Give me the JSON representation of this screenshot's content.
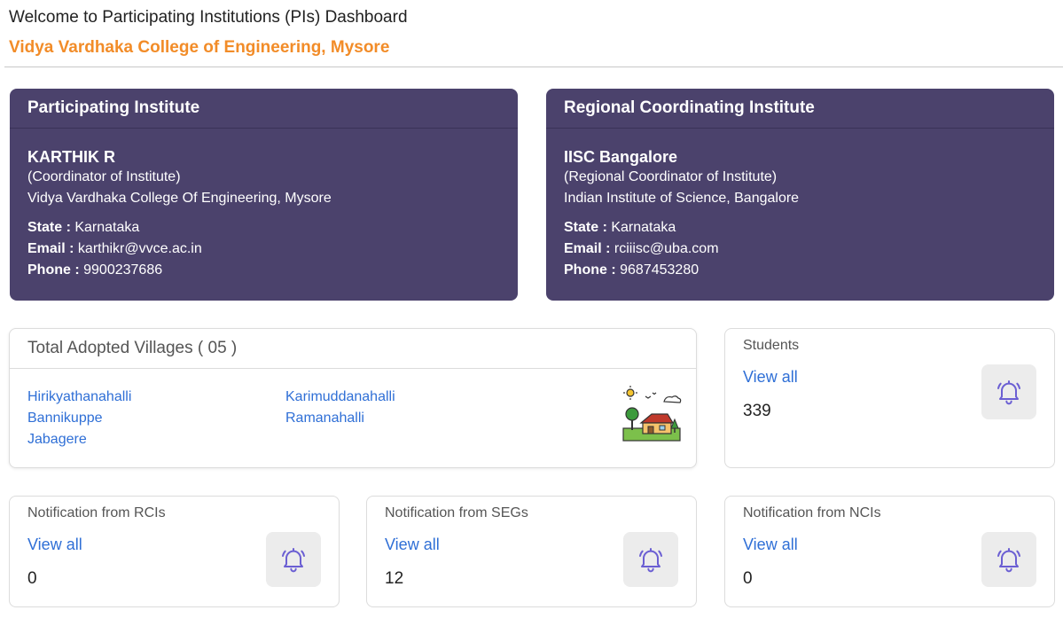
{
  "header": {
    "welcome": "Welcome to Participating Institutions (PIs) Dashboard",
    "college": "Vidya Vardhaka College of Engineering, Mysore"
  },
  "pi_card": {
    "title": "Participating Institute",
    "name": "KARTHIK R",
    "role": "(Coordinator of Institute)",
    "institution": "Vidya Vardhaka College Of Engineering, Mysore",
    "state_label": "State :",
    "state": "Karnataka",
    "email_label": "Email :",
    "email": "karthikr@vvce.ac.in",
    "phone_label": "Phone :",
    "phone": "9900237686"
  },
  "rci_card": {
    "title": "Regional Coordinating Institute",
    "name": "IISC Bangalore",
    "role": "(Regional Coordinator of Institute)",
    "institution": "Indian Institute of Science, Bangalore",
    "state_label": "State :",
    "state": "Karnataka",
    "email_label": "Email :",
    "email": "rciiisc@uba.com",
    "phone_label": "Phone :",
    "phone": "9687453280"
  },
  "villages": {
    "title": "Total Adopted Villages ( 05 )",
    "items": [
      "Hirikyathanahalli",
      "Karimuddanahalli",
      "Bannikuppe",
      "Ramanahalli",
      "Jabagere"
    ]
  },
  "students": {
    "title": "Students",
    "view_all": "View all",
    "count": "339"
  },
  "notif_rci": {
    "title": "Notification from RCIs",
    "view_all": "View all",
    "count": "0"
  },
  "notif_seg": {
    "title": "Notification from SEGs",
    "view_all": "View all",
    "count": "12"
  },
  "notif_nci": {
    "title": "Notification from NCIs",
    "view_all": "View all",
    "count": "0"
  },
  "icons": {
    "bell": "bell-icon",
    "village": "village-illustration-icon"
  },
  "colors": {
    "card_bg": "#4b426c",
    "accent_orange": "#f28c28",
    "link_blue": "#2f6fd6",
    "bell": "#6b5fd3"
  }
}
